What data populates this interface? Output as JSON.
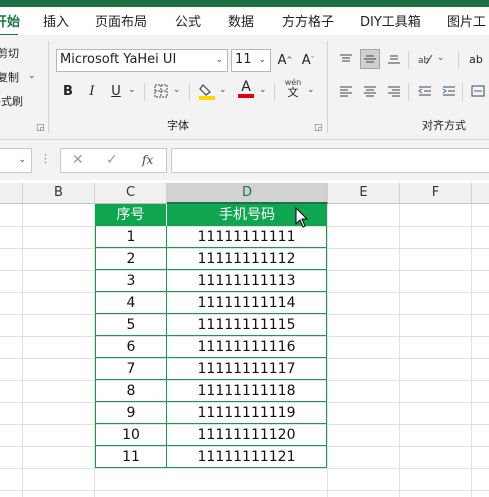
{
  "ribbon_tabs": [
    "开始",
    "插入",
    "页面布局",
    "公式",
    "数据",
    "方方格子",
    "DIY工具箱",
    "图片工"
  ],
  "clipboard": {
    "cut": "剪切",
    "copy": "复制",
    "format_painter": "格式刷"
  },
  "font_group": {
    "font_name": "Microsoft YaHei UI",
    "font_size": "11",
    "bold": "B",
    "italic": "I",
    "underline": "U",
    "grow_font": "A",
    "shrink_font": "A",
    "font_color": "A",
    "phonetic": "wén",
    "label": "字体",
    "fill_color_hex": "#ffd800",
    "font_color_hex": "#e00000"
  },
  "alignment_group": {
    "label": "对齐方式"
  },
  "formula_bar": {
    "fx": "fx",
    "value": ""
  },
  "columns": [
    "B",
    "C",
    "D",
    "E",
    "F"
  ],
  "selected_column": "D",
  "table": {
    "header_color": "#10a550",
    "headers": [
      "序号",
      "手机号码"
    ],
    "rows": [
      [
        "1",
        "11111111111"
      ],
      [
        "2",
        "11111111112"
      ],
      [
        "3",
        "11111111113"
      ],
      [
        "4",
        "11111111114"
      ],
      [
        "5",
        "11111111115"
      ],
      [
        "6",
        "11111111116"
      ],
      [
        "7",
        "11111111117"
      ],
      [
        "8",
        "11111111118"
      ],
      [
        "9",
        "11111111119"
      ],
      [
        "10",
        "11111111120"
      ],
      [
        "11",
        "11111111121"
      ]
    ]
  }
}
